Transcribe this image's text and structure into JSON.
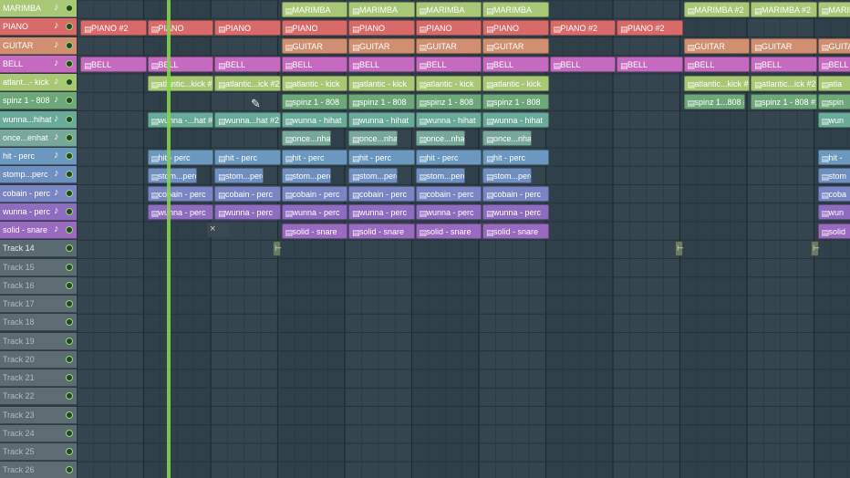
{
  "tracks": [
    {
      "name": "MARIMBA",
      "color": "#a8c878",
      "text_color": "#ffffff"
    },
    {
      "name": "PIANO",
      "color": "#d86a6a",
      "text_color": "#ffffff"
    },
    {
      "name": "GUITAR",
      "color": "#cf8f70",
      "text_color": "#ffffff"
    },
    {
      "name": "BELL",
      "color": "#c56ac0",
      "text_color": "#ffffff"
    },
    {
      "name": "atlant...- kick",
      "color": "#a9c876",
      "text_color": "#ffffff"
    },
    {
      "name": "spinz 1 - 808",
      "color": "#6ea87a",
      "text_color": "#ffffff"
    },
    {
      "name": "wunna...hihat",
      "color": "#6aaa98",
      "text_color": "#ffffff"
    },
    {
      "name": "once...enhat",
      "color": "#78a89a",
      "text_color": "#ffffff"
    },
    {
      "name": "hit - perc",
      "color": "#6c98bf",
      "text_color": "#ffffff"
    },
    {
      "name": "stomp...perc",
      "color": "#6f8fc0",
      "text_color": "#ffffff"
    },
    {
      "name": "cobain - perc",
      "color": "#7a86c4",
      "text_color": "#ffffff"
    },
    {
      "name": "wunna - perc",
      "color": "#8e6cc0",
      "text_color": "#ffffff"
    },
    {
      "name": "solid - snare",
      "color": "#9a6ac0",
      "text_color": "#ffffff"
    },
    {
      "name": "Track 14",
      "color": "#5a6a72",
      "text_color": "#e8eef0"
    },
    {
      "name": "Track 15",
      "color": "#5d6c73",
      "text_color": "#aebac0"
    },
    {
      "name": "Track 16",
      "color": "#5d6c73",
      "text_color": "#aebac0"
    },
    {
      "name": "Track 17",
      "color": "#5d6c73",
      "text_color": "#aebac0"
    },
    {
      "name": "Track 18",
      "color": "#5d6c73",
      "text_color": "#aebac0"
    },
    {
      "name": "Track 19",
      "color": "#5d6c73",
      "text_color": "#aebac0"
    },
    {
      "name": "Track 20",
      "color": "#5d6c73",
      "text_color": "#aebac0"
    },
    {
      "name": "Track 21",
      "color": "#5d6c73",
      "text_color": "#aebac0"
    },
    {
      "name": "Track 22",
      "color": "#5d6c73",
      "text_color": "#aebac0"
    },
    {
      "name": "Track 23",
      "color": "#5d6c73",
      "text_color": "#aebac0"
    },
    {
      "name": "Track 24",
      "color": "#5d6c73",
      "text_color": "#aebac0"
    },
    {
      "name": "Track 25",
      "color": "#5d6c73",
      "text_color": "#aebac0"
    },
    {
      "name": "Track 26",
      "color": "#5d6c73",
      "text_color": "#aebac0"
    }
  ],
  "icons": {
    "note": "note-icon",
    "led": "track-active-led-icon",
    "grip": "pattern-grip-icon",
    "marker": "time-marker-icon",
    "cursor": "pointer-cursor-icon",
    "close": "close-icon"
  },
  "clips": [
    {
      "label": "MARIMBA",
      "color": "#a8c878"
    },
    {
      "label": "MARIMBA",
      "color": "#a8c878"
    },
    {
      "label": "MARIMBA",
      "color": "#a8c878"
    },
    {
      "label": "MARIMBA",
      "color": "#a8c878"
    },
    {
      "label": "MARIMBA #2",
      "color": "#a8c878"
    },
    {
      "label": "MARIMBA #2",
      "color": "#a8c878"
    },
    {
      "label": "MARIMBA",
      "color": "#a8c878"
    },
    {
      "label": "PIANO #2",
      "color": "#d86a6a"
    },
    {
      "label": "PIANO",
      "color": "#d86a6a"
    },
    {
      "label": "PIANO",
      "color": "#d86a6a"
    },
    {
      "label": "PIANO",
      "color": "#d86a6a"
    },
    {
      "label": "PIANO",
      "color": "#d86a6a"
    },
    {
      "label": "PIANO",
      "color": "#d86a6a"
    },
    {
      "label": "PIANO",
      "color": "#d86a6a"
    },
    {
      "label": "PIANO #2",
      "color": "#d86a6a"
    },
    {
      "label": "PIANO #2",
      "color": "#d86a6a"
    },
    {
      "label": "GUITAR",
      "color": "#cf8f70"
    },
    {
      "label": "GUITAR",
      "color": "#cf8f70"
    },
    {
      "label": "GUITAR",
      "color": "#cf8f70"
    },
    {
      "label": "GUITAR",
      "color": "#cf8f70"
    },
    {
      "label": "GUITAR",
      "color": "#cf8f70"
    },
    {
      "label": "GUITAR",
      "color": "#cf8f70"
    },
    {
      "label": "GUITA",
      "color": "#cf8f70"
    },
    {
      "label": "BELL",
      "color": "#c56ac0"
    },
    {
      "label": "BELL",
      "color": "#c56ac0"
    },
    {
      "label": "BELL",
      "color": "#c56ac0"
    },
    {
      "label": "BELL",
      "color": "#c56ac0"
    },
    {
      "label": "BELL",
      "color": "#c56ac0"
    },
    {
      "label": "BELL",
      "color": "#c56ac0"
    },
    {
      "label": "BELL",
      "color": "#c56ac0"
    },
    {
      "label": "BELL",
      "color": "#c56ac0"
    },
    {
      "label": "BELL",
      "color": "#c56ac0"
    },
    {
      "label": "BELL",
      "color": "#c56ac0"
    },
    {
      "label": "BELL",
      "color": "#c56ac0"
    },
    {
      "label": "BELL",
      "color": "#c56ac0"
    },
    {
      "label": "atlantic...kick #2",
      "color": "#a9c876"
    },
    {
      "label": "atlantic...ick #2",
      "color": "#a9c876"
    },
    {
      "label": "atlantic - kick",
      "color": "#a9c876"
    },
    {
      "label": "atlantic - kick",
      "color": "#a9c876"
    },
    {
      "label": "atlantic - kick",
      "color": "#a9c876"
    },
    {
      "label": "atlantic - kick",
      "color": "#a9c876"
    },
    {
      "label": "atlantic...kick #2",
      "color": "#a9c876"
    },
    {
      "label": "atlantic...ick #2",
      "color": "#a9c876"
    },
    {
      "label": "atla",
      "color": "#a9c876"
    },
    {
      "label": "spinz 1 - 808",
      "color": "#6ea87a"
    },
    {
      "label": "spinz 1 - 808",
      "color": "#6ea87a"
    },
    {
      "label": "spinz 1 - 808",
      "color": "#6ea87a"
    },
    {
      "label": "spinz 1 - 808",
      "color": "#6ea87a"
    },
    {
      "label": "spinz 1...808 #2",
      "color": "#6ea87a"
    },
    {
      "label": "spinz 1 - 808 #2",
      "color": "#6ea87a"
    },
    {
      "label": "spin",
      "color": "#6ea87a"
    },
    {
      "label": "wunna -...hat #2",
      "color": "#6aaa98"
    },
    {
      "label": "wunna...hat #2",
      "color": "#6aaa98"
    },
    {
      "label": "wunna - hihat",
      "color": "#6aaa98"
    },
    {
      "label": "wunna - hihat",
      "color": "#6aaa98"
    },
    {
      "label": "wunna - hihat",
      "color": "#6aaa98"
    },
    {
      "label": "wunna - hihat",
      "color": "#6aaa98"
    },
    {
      "label": "wun",
      "color": "#6aaa98"
    },
    {
      "label": "once...nhat",
      "color": "#78a89a"
    },
    {
      "label": "once...nhat",
      "color": "#78a89a"
    },
    {
      "label": "once...nhat",
      "color": "#78a89a"
    },
    {
      "label": "once...nhat",
      "color": "#78a89a"
    },
    {
      "label": "hit - perc",
      "color": "#6c98bf"
    },
    {
      "label": "hit - perc",
      "color": "#6c98bf"
    },
    {
      "label": "hit - perc",
      "color": "#6c98bf"
    },
    {
      "label": "hit - perc",
      "color": "#6c98bf"
    },
    {
      "label": "hit - perc",
      "color": "#6c98bf"
    },
    {
      "label": "hit - perc",
      "color": "#6c98bf"
    },
    {
      "label": "hit -",
      "color": "#6c98bf"
    },
    {
      "label": "stom...perc",
      "color": "#6f8fc0"
    },
    {
      "label": "stom...perc",
      "color": "#6f8fc0"
    },
    {
      "label": "stom...perc",
      "color": "#6f8fc0"
    },
    {
      "label": "stom...perc",
      "color": "#6f8fc0"
    },
    {
      "label": "stom...perc",
      "color": "#6f8fc0"
    },
    {
      "label": "stom...perc",
      "color": "#6f8fc0"
    },
    {
      "label": "stom",
      "color": "#6f8fc0"
    },
    {
      "label": "cobain - perc",
      "color": "#7a86c4"
    },
    {
      "label": "cobain - perc",
      "color": "#7a86c4"
    },
    {
      "label": "cobain - perc",
      "color": "#7a86c4"
    },
    {
      "label": "cobain - perc",
      "color": "#7a86c4"
    },
    {
      "label": "cobain - perc",
      "color": "#7a86c4"
    },
    {
      "label": "cobain - perc",
      "color": "#7a86c4"
    },
    {
      "label": "coba",
      "color": "#7a86c4"
    },
    {
      "label": "wunna - perc",
      "color": "#8e6cc0"
    },
    {
      "label": "wunna - perc",
      "color": "#8e6cc0"
    },
    {
      "label": "wunna - perc",
      "color": "#8e6cc0"
    },
    {
      "label": "wunna - perc",
      "color": "#8e6cc0"
    },
    {
      "label": "wunna - perc",
      "color": "#8e6cc0"
    },
    {
      "label": "wunna - perc",
      "color": "#8e6cc0"
    },
    {
      "label": "wun",
      "color": "#8e6cc0"
    },
    {
      "label": "solid - snare",
      "color": "#9a6ac0"
    },
    {
      "label": "solid - snare",
      "color": "#9a6ac0"
    },
    {
      "label": "solid - snare",
      "color": "#9a6ac0"
    },
    {
      "label": "solid - snare",
      "color": "#9a6ac0"
    },
    {
      "label": "solid",
      "color": "#9a6ac0"
    }
  ],
  "ghost_close": "×",
  "marker_glyph": "⊢"
}
